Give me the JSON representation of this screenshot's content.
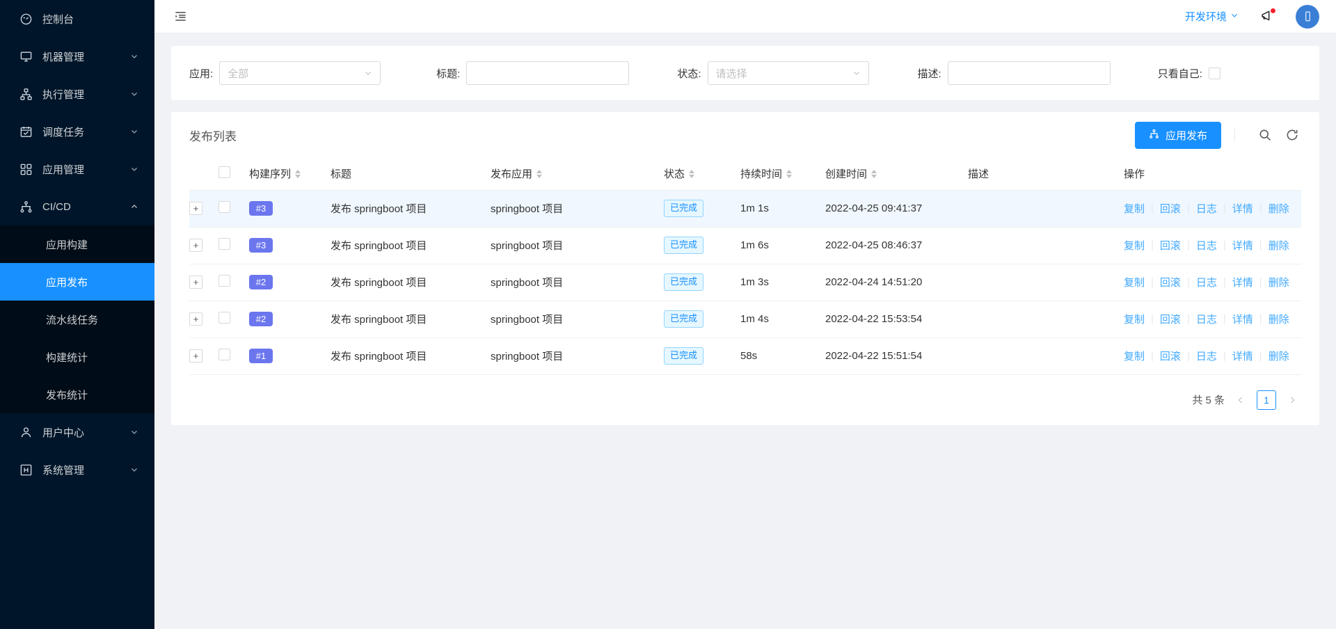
{
  "sidebar": {
    "items": [
      {
        "label": "控制台",
        "icon": "dashboard-icon",
        "expandable": false
      },
      {
        "label": "机器管理",
        "icon": "desktop-icon",
        "expandable": true
      },
      {
        "label": "执行管理",
        "icon": "cluster-icon",
        "expandable": true
      },
      {
        "label": "调度任务",
        "icon": "schedule-icon",
        "expandable": true
      },
      {
        "label": "应用管理",
        "icon": "appstore-icon",
        "expandable": true
      },
      {
        "label": "CI/CD",
        "icon": "branches-icon",
        "expandable": true,
        "expanded": true
      },
      {
        "label": "用户中心",
        "icon": "user-icon",
        "expandable": true
      },
      {
        "label": "系统管理",
        "icon": "setting-box-icon",
        "expandable": true
      }
    ],
    "submenu": [
      {
        "label": "应用构建",
        "active": false
      },
      {
        "label": "应用发布",
        "active": true
      },
      {
        "label": "流水线任务",
        "active": false
      },
      {
        "label": "构建统计",
        "active": false
      },
      {
        "label": "发布统计",
        "active": false
      }
    ]
  },
  "topbar": {
    "fold_icon": "menu-fold-icon",
    "env_label": "开发环境",
    "env_caret": "chevron-down-icon",
    "notification_icon": "megaphone-icon",
    "notification_badge": true,
    "avatar_icon": "user-avatar-icon"
  },
  "filters": {
    "app": {
      "label": "应用:",
      "value": "全部",
      "placeholder": "全部",
      "is_placeholder": true
    },
    "title": {
      "label": "标题:",
      "value": "",
      "placeholder": ""
    },
    "status": {
      "label": "状态:",
      "value": "请选择",
      "placeholder": "请选择",
      "is_placeholder": true
    },
    "desc": {
      "label": "描述:",
      "value": "",
      "placeholder": ""
    },
    "only_mine": {
      "label": "只看自己:",
      "checked": false
    }
  },
  "card": {
    "title": "发布列表",
    "primary_button": {
      "label": "应用发布",
      "icon": "branches-icon",
      "color": "#1890ff"
    },
    "search_icon": "search-icon",
    "refresh_icon": "reload-icon"
  },
  "table": {
    "columns": [
      {
        "key": "expand",
        "label": "",
        "sortable": false
      },
      {
        "key": "check",
        "label": "",
        "sortable": false
      },
      {
        "key": "seq",
        "label": "构建序列",
        "sortable": true
      },
      {
        "key": "title",
        "label": "标题",
        "sortable": false
      },
      {
        "key": "app",
        "label": "发布应用",
        "sortable": true
      },
      {
        "key": "status",
        "label": "状态",
        "sortable": true
      },
      {
        "key": "duration",
        "label": "持续时间",
        "sortable": true
      },
      {
        "key": "created",
        "label": "创建时间",
        "sortable": true
      },
      {
        "key": "desc",
        "label": "描述",
        "sortable": false
      },
      {
        "key": "ops",
        "label": "操作",
        "sortable": false
      }
    ],
    "rows": [
      {
        "expand": "+",
        "seq": "#3",
        "title": "发布 springboot 项目",
        "app": "springboot 项目",
        "status": "已完成",
        "duration": "1m 1s",
        "created": "2022-04-25 09:41:37",
        "desc": "",
        "highlight": true
      },
      {
        "expand": "+",
        "seq": "#3",
        "title": "发布 springboot 项目",
        "app": "springboot 项目",
        "status": "已完成",
        "duration": "1m 6s",
        "created": "2022-04-25 08:46:37",
        "desc": "",
        "highlight": false
      },
      {
        "expand": "+",
        "seq": "#2",
        "title": "发布 springboot 项目",
        "app": "springboot 项目",
        "status": "已完成",
        "duration": "1m 3s",
        "created": "2022-04-24 14:51:20",
        "desc": "",
        "highlight": false
      },
      {
        "expand": "+",
        "seq": "#2",
        "title": "发布 springboot 项目",
        "app": "springboot 项目",
        "status": "已完成",
        "duration": "1m 4s",
        "created": "2022-04-22 15:53:54",
        "desc": "",
        "highlight": false
      },
      {
        "expand": "+",
        "seq": "#1",
        "title": "发布 springboot 项目",
        "app": "springboot 项目",
        "status": "已完成",
        "duration": "58s",
        "created": "2022-04-22 15:51:54",
        "desc": "",
        "highlight": false
      }
    ],
    "row_actions": [
      "复制",
      "回滚",
      "日志",
      "详情",
      "删除"
    ]
  },
  "pagination": {
    "total_text": "共 5 条",
    "prev_icon": "chevron-left-icon",
    "next_icon": "chevron-right-icon",
    "current_page": "1"
  },
  "colors": {
    "accent": "#1890ff",
    "sidebar_bg": "#001529",
    "submenu_bg": "#000c17",
    "badge": "#6b76ee",
    "tag_text": "#1890ff",
    "tag_bg": "#e6f7ff",
    "row_highlight": "#f0f7ff",
    "page_bg": "#f0f2f5"
  }
}
